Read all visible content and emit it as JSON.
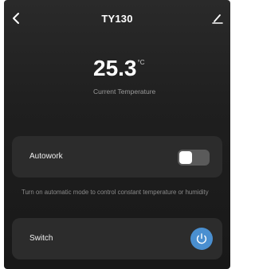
{
  "header": {
    "title": "TY130"
  },
  "temperature": {
    "value": "25.3",
    "unit": "°C",
    "caption": "Current Temperature"
  },
  "autowork": {
    "label": "Autowork",
    "enabled": false,
    "hint": "Turn on automatic mode to control constant temperature or humidity"
  },
  "switch": {
    "label": "Switch"
  },
  "icons": {
    "back": "chevron-left-icon",
    "edit": "pencil-icon",
    "power": "power-icon"
  },
  "colors": {
    "accent": "#4a8fd0",
    "background": "#1f1f1f",
    "card": "#2c2c2c"
  }
}
